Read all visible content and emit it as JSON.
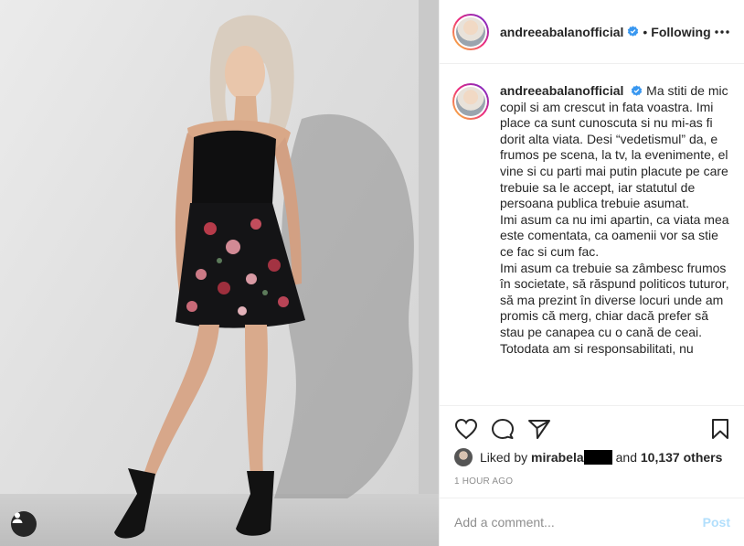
{
  "post": {
    "username": "andreeabalanofficial",
    "separator": "•",
    "follow_status": "Following",
    "more_icon": "more-horizontal-icon",
    "verified_color": "#3897f0"
  },
  "caption": {
    "username": "andreeabalanofficial",
    "paragraphs": [
      "Ma stiti de mic copil si am crescut in fata voastra. Imi place ca sunt cunoscuta si nu mi-as fi dorit alta viata. Desi “vedetismul” da, e frumos pe scena, la tv, la evenimente, el vine si cu parti mai putin placute pe care trebuie sa le accept, iar statutul de persoana publica trebuie asumat.",
      "Imi asum ca nu imi apartin, ca viata mea este comentata, ca oamenii vor sa stie ce fac si cum fac.",
      "Imi asum ca trebuie sa zâmbesc frumos în societate, să răspund politicos tuturor, să ma prezint în diverse locuri unde am promis că merg, chiar dacă prefer să stau pe canapea cu o cană de ceai.",
      "Totodata am si responsabilitati, nu"
    ]
  },
  "likes": {
    "prefix": "Liked by",
    "liker": "mirabela",
    "conjunction": "and",
    "count_text": "10,137 others"
  },
  "timestamp": "1 HOUR AGO",
  "comment": {
    "placeholder": "Add a comment...",
    "post_label": "Post"
  },
  "colors": {
    "accent": "#3897f0",
    "post_disabled": "#b2dffc",
    "muted": "#8e8e8e",
    "text": "#262626"
  }
}
